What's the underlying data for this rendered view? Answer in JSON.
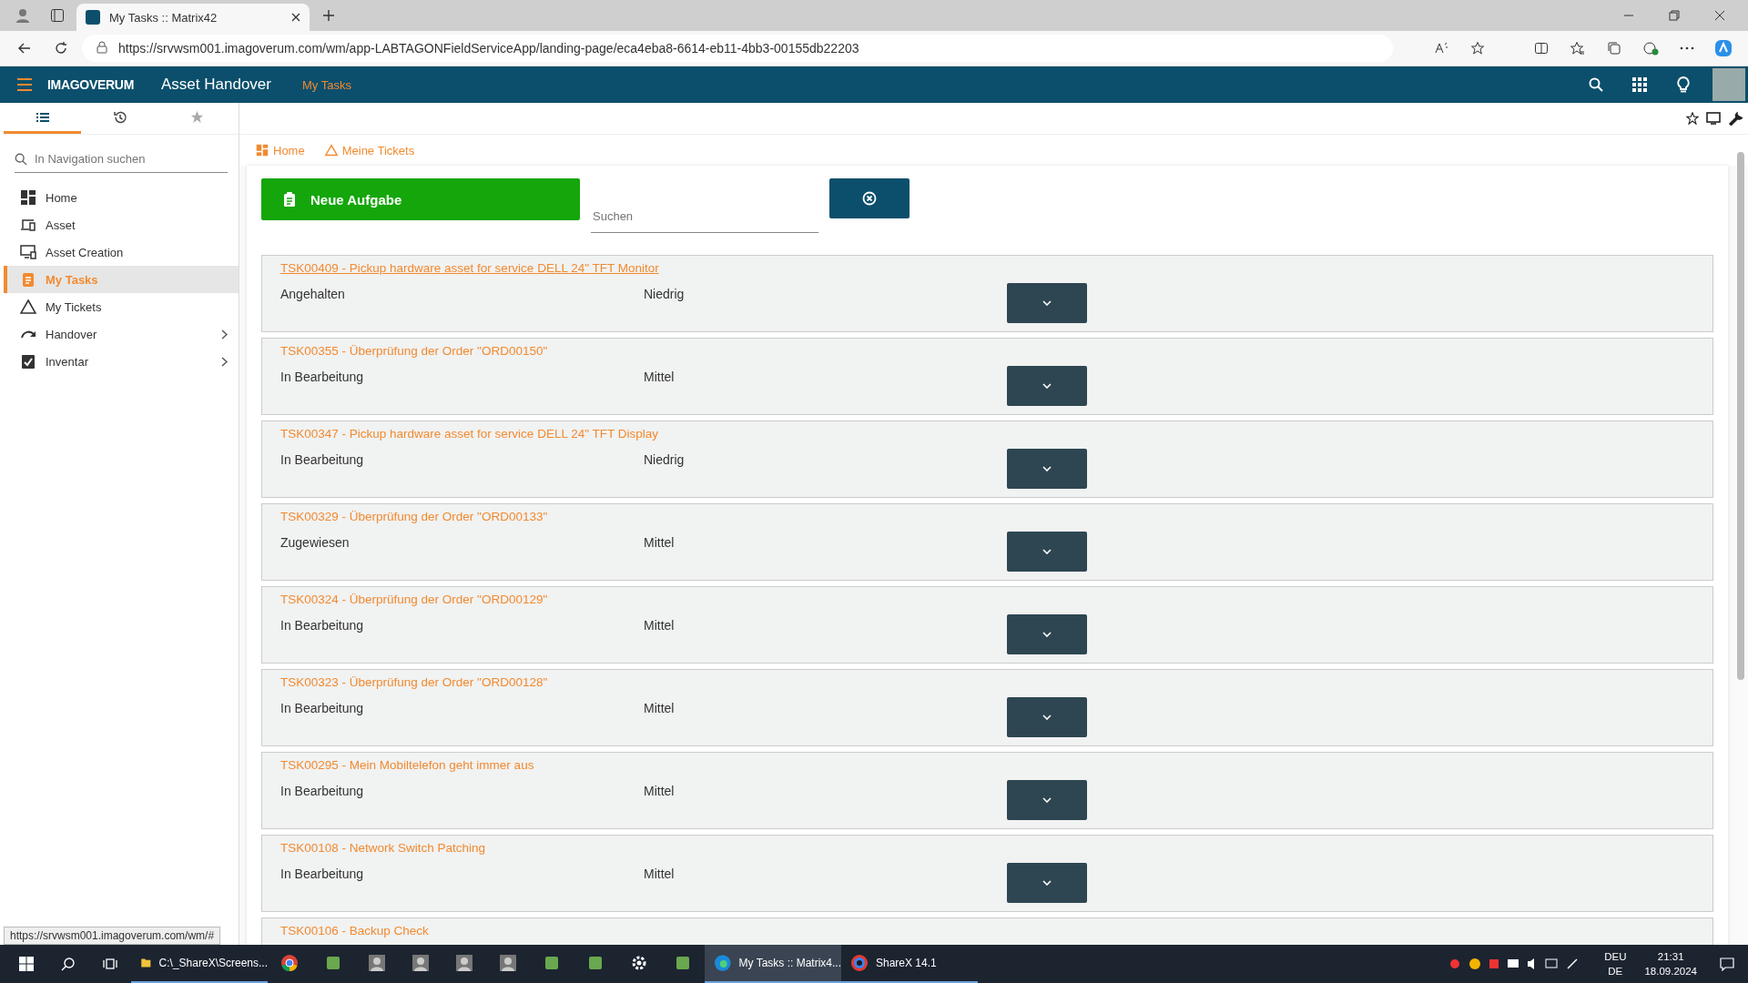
{
  "browser": {
    "tab_title": "My Tasks :: Matrix42",
    "url": "https://srvwsm001.imagoverum.com/wm/app-LABTAGONFieldServiceApp/landing-page/eca4eba8-6614-eb11-4bb3-00155db22203"
  },
  "app": {
    "logo": "IMAGOVERUM",
    "title": "Asset Handover",
    "section": "My Tasks"
  },
  "sidebar": {
    "tabs": [
      {
        "kind": "list",
        "selected": true
      },
      {
        "kind": "history",
        "selected": false
      },
      {
        "kind": "star",
        "selected": false
      }
    ],
    "search_placeholder": "In Navigation suchen",
    "items": [
      {
        "label": "Home",
        "selected": false,
        "has_children": false
      },
      {
        "label": "Asset",
        "selected": false,
        "has_children": false
      },
      {
        "label": "Asset Creation",
        "selected": false,
        "has_children": false
      },
      {
        "label": "My Tasks",
        "selected": true,
        "has_children": false
      },
      {
        "label": "My Tickets",
        "selected": false,
        "has_children": false
      },
      {
        "label": "Handover",
        "selected": false,
        "has_children": true
      },
      {
        "label": "Inventar",
        "selected": false,
        "has_children": true
      }
    ]
  },
  "breadcrumbs": [
    {
      "label": "Home"
    },
    {
      "label": "Meine Tickets"
    }
  ],
  "toolbar": {
    "new_button": "Neue Aufgabe",
    "search_placeholder": "Suchen"
  },
  "tasks": [
    {
      "title": "TSK00409 - Pickup hardware asset for service DELL 24\" TFT Monitor",
      "status": "Angehalten",
      "priority": "Niedrig",
      "hovered": true
    },
    {
      "title": "TSK00355 - Überprüfung der Order \"ORD00150\"",
      "status": "In Bearbeitung",
      "priority": "Mittel",
      "hovered": false
    },
    {
      "title": "TSK00347 - Pickup hardware asset for service DELL 24\" TFT Display",
      "status": "In Bearbeitung",
      "priority": "Niedrig",
      "hovered": false
    },
    {
      "title": "TSK00329 - Überprüfung der Order \"ORD00133\"",
      "status": "Zugewiesen",
      "priority": "Mittel",
      "hovered": false
    },
    {
      "title": "TSK00324 - Überprüfung der Order \"ORD00129\"",
      "status": "In Bearbeitung",
      "priority": "Mittel",
      "hovered": false
    },
    {
      "title": "TSK00323 - Überprüfung der Order \"ORD00128\"",
      "status": "In Bearbeitung",
      "priority": "Mittel",
      "hovered": false
    },
    {
      "title": "TSK00295 - Mein Mobiltelefon geht immer aus",
      "status": "In Bearbeitung",
      "priority": "Mittel",
      "hovered": false
    },
    {
      "title": "TSK00108 - Network Switch Patching",
      "status": "In Bearbeitung",
      "priority": "Mittel",
      "hovered": false
    },
    {
      "title": "TSK00106 - Backup Check",
      "hovered": false
    }
  ],
  "status_url": "https://srvwsm001.imagoverum.com/wm/#",
  "taskbar": {
    "items": [
      {
        "kind": "folder",
        "label": "C:\\_ShareX\\Screens...",
        "active": false
      },
      {
        "kind": "chrome",
        "active": false
      },
      {
        "kind": "app",
        "active": false
      },
      {
        "kind": "avatar",
        "active": false
      },
      {
        "kind": "avatar",
        "active": false
      },
      {
        "kind": "avatar",
        "active": false
      },
      {
        "kind": "avatar",
        "active": false
      },
      {
        "kind": "app",
        "active": false
      },
      {
        "kind": "app",
        "active": false
      },
      {
        "kind": "gear",
        "active": false
      },
      {
        "kind": "app",
        "active": false
      },
      {
        "kind": "edge",
        "label": "My Tasks :: Matrix4...",
        "active": true
      },
      {
        "kind": "sharex",
        "label": "ShareX 14.1",
        "active": false
      }
    ],
    "lang": "DEU",
    "lang2": "DE",
    "time": "21:31",
    "date": "18.09.2024"
  }
}
